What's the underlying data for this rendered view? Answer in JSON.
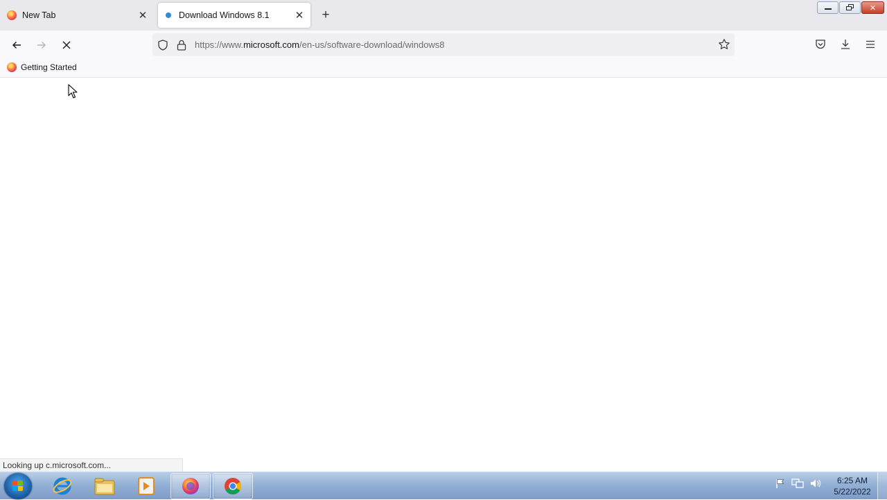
{
  "browser": {
    "tabs": [
      {
        "label": "New Tab",
        "favicon": "firefox-icon",
        "active": false
      },
      {
        "label": "Download Windows 8.1",
        "favicon": "microsoft-icon",
        "active": true
      }
    ],
    "url": {
      "prefix": "https://www.",
      "host": "microsoft.com",
      "path": "/en-us/software-download/windows8"
    },
    "bookmarks": [
      {
        "label": "Getting Started",
        "icon": "firefox-icon"
      }
    ],
    "status": "Looking up c.microsoft.com..."
  },
  "window_controls": {
    "minimize": "minimize-icon",
    "restore": "restore-icon",
    "close": "close-icon"
  },
  "taskbar": {
    "items": [
      "internet-explorer-icon",
      "windows-explorer-icon",
      "media-player-icon",
      "firefox-icon",
      "chrome-icon"
    ],
    "clock": {
      "time": "6:25 AM",
      "date": "5/22/2022"
    }
  },
  "colors": {
    "tabstrip_bg": "#e9e9ed",
    "toolbar_bg": "#f9f9fb",
    "taskbar_gradient_top": "#b9cde6",
    "accent_blue": "#2f8bd6"
  }
}
